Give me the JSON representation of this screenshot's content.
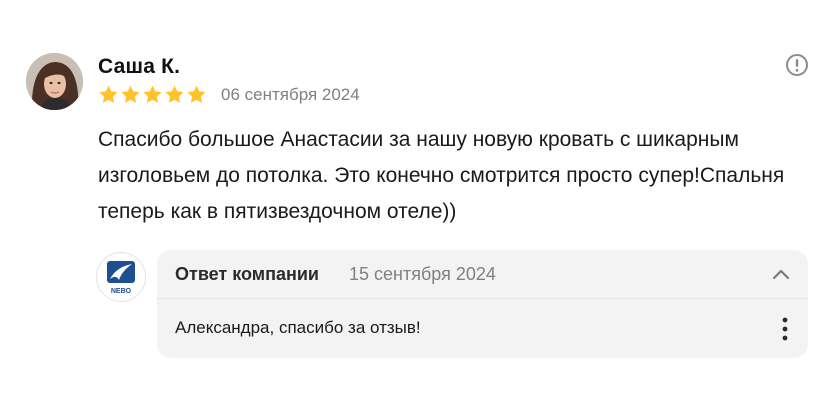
{
  "review": {
    "author_name": "Саша К.",
    "rating": 5,
    "rating_max": 5,
    "date": "06 сентября 2024",
    "text": "Спасибо большое Анастасии за нашу новую кровать с шикарным изголовьем до потолка. Это конечно смотрится просто супер!Спальня теперь как в пятизвездочном отеле))",
    "avatar_icon": "user-photo",
    "report_icon": "exclamation-circle-icon"
  },
  "reply": {
    "title": "Ответ компании",
    "date": "15 сентября 2024",
    "text": "Александра, спасибо за отзыв!",
    "logo_text": "NEBO",
    "collapse_icon": "chevron-up-icon",
    "menu_icon": "vertical-dots-icon"
  },
  "colors": {
    "star": "#FFC22D",
    "muted_text": "#808080",
    "reply_bg": "#F3F3F3",
    "logo_blue": "#1D4F91"
  }
}
